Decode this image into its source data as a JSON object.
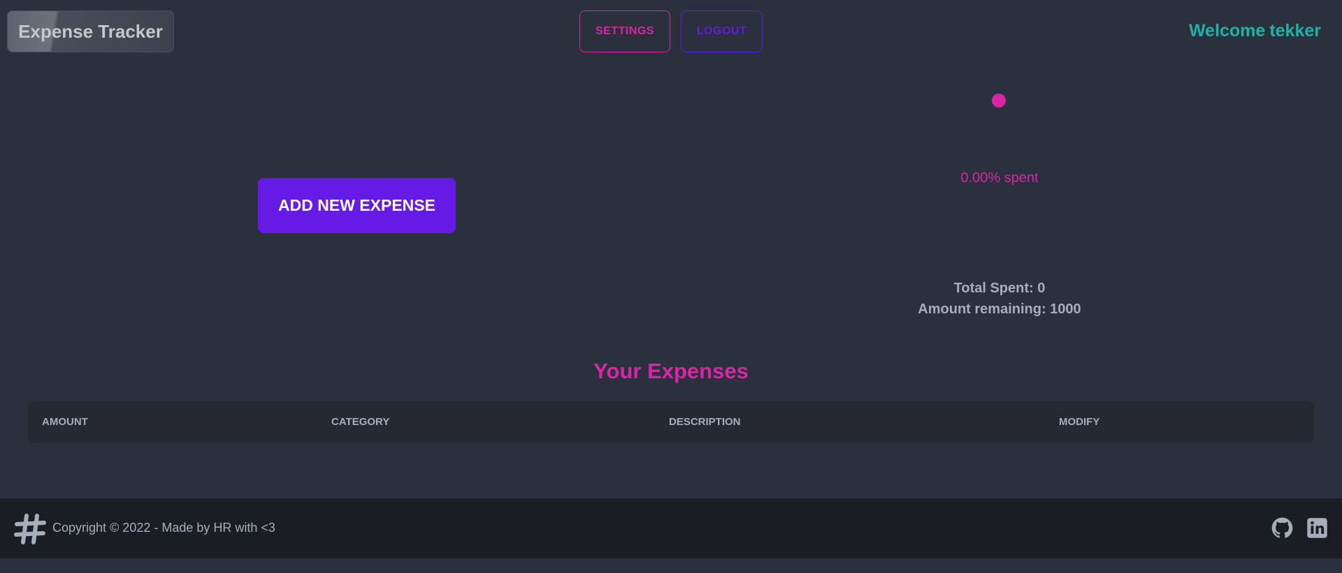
{
  "navbar": {
    "brand": "Expense Tracker",
    "settings_label": "SETTINGS",
    "logout_label": "LOGOUT",
    "welcome_prefix": "Welcome",
    "username": "tekker"
  },
  "actions": {
    "add_expense_label": "ADD NEW EXPENSE"
  },
  "budget": {
    "percent_spent_label": "0.00% spent",
    "percent_spent_value": 0,
    "total_spent_label": "Total Spent: 0",
    "amount_remaining_label": "Amount remaining: 1000",
    "accent_color": "#d926a9"
  },
  "expenses": {
    "title": "Your Expenses",
    "columns": [
      "AMOUNT",
      "CATEGORY",
      "DESCRIPTION",
      "MODIFY"
    ],
    "rows": []
  },
  "footer": {
    "logo_icon": "hashtag-icon",
    "copyright": "Copyright © 2022 - Made by HR with <3",
    "social_icons": [
      "github-icon",
      "linkedin-icon"
    ]
  },
  "theme": {
    "background": "#2a303c",
    "primary": "#661ae6",
    "secondary": "#d926a9",
    "accent": "#1fb2a6",
    "footer_bg": "#1a1d24"
  }
}
